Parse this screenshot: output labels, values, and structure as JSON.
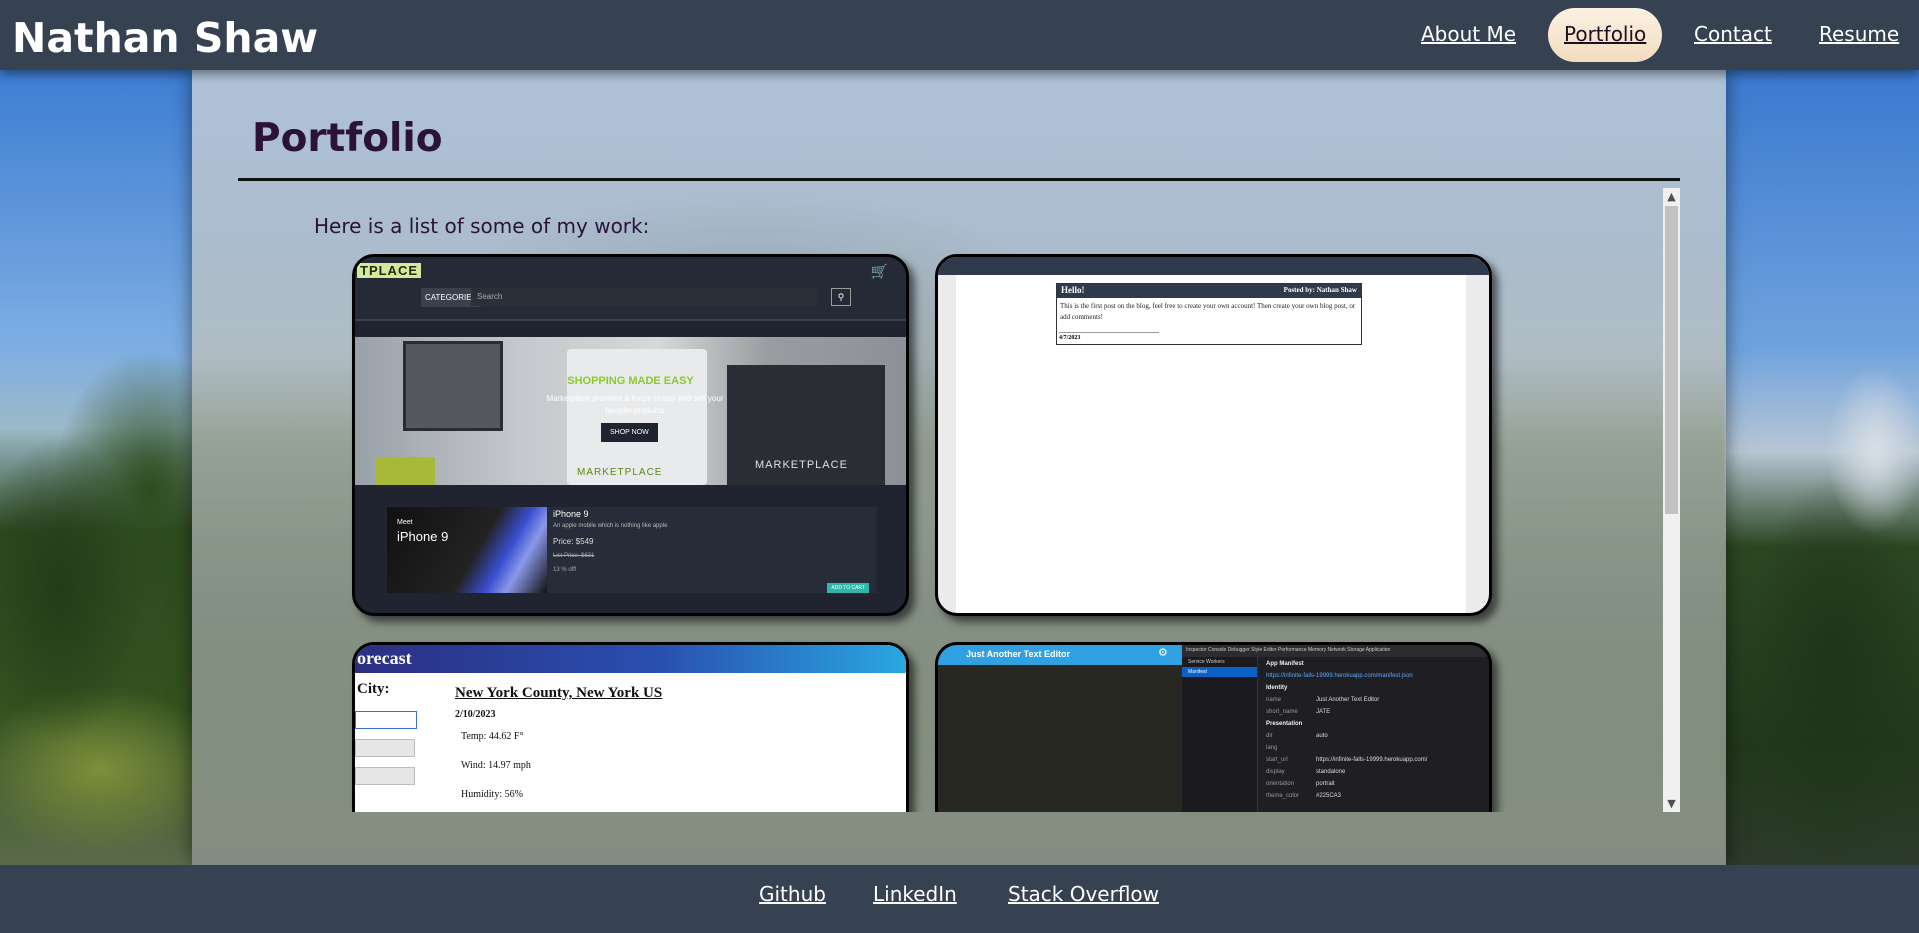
{
  "header": {
    "site_title": "Nathan Shaw",
    "nav": [
      {
        "label": "About Me",
        "active": false
      },
      {
        "label": "Portfolio",
        "active": true
      },
      {
        "label": "Contact",
        "active": false
      },
      {
        "label": "Resume",
        "active": false
      }
    ]
  },
  "main": {
    "heading": "Portfolio",
    "intro": "Here is a list of some of my work:"
  },
  "projects": {
    "marketplace": {
      "logo": "TPLACE",
      "categories_label": "CATEGORIES",
      "search_placeholder": "Search",
      "hero_title": "SHOPPING MADE EASY",
      "hero_subtitle": "Marketplace provides a forum to buy and sell your favorite products",
      "shop_button": "SHOP NOW",
      "brand": "MARKETPLACE",
      "product": {
        "meet": "Meet",
        "image_name": "iPhone 9",
        "title": "iPhone 9",
        "description": "An apple mobile which is nothing like apple",
        "price": "Price: $549",
        "list_price": "List Price: $631",
        "discount": "13 % off!",
        "add_to_cart": "ADD TO CART"
      }
    },
    "blog": {
      "post_title": "Hello!",
      "posted_by": "Posted by: Nathan Shaw",
      "post_body": "This is the first post on the blog, feel free to create your own account! Then create your own blog post, or add comments!",
      "post_date": "4/7/2023"
    },
    "weather": {
      "title": "orecast",
      "city_label": "City:",
      "location": "New York County, New York US",
      "date": "2/10/2023",
      "temp": "Temp: 44.62 F°",
      "wind": "Wind: 14.97 mph",
      "humidity": "Humidity: 56%"
    },
    "text_editor": {
      "app_title": "Just Another Text Editor",
      "toolbar": "Inspector   Console   Debugger   Style Editor   Performance   Memory   Network   Storage   Application",
      "side_items": [
        "Service Workers",
        "Manifest"
      ],
      "panel_title": "App Manifest",
      "manifest_url": "https://infinite-falls-19999.herokuapp.com/manifest.json",
      "identity_label": "Identity",
      "presentation_label": "Presentation",
      "fields": [
        {
          "k": "name",
          "v": "Just Another Text Editor"
        },
        {
          "k": "short_name",
          "v": "JATE"
        }
      ],
      "pres_fields": [
        {
          "k": "dir",
          "v": "auto"
        },
        {
          "k": "lang",
          "v": ""
        },
        {
          "k": "start_url",
          "v": "https://infinite-falls-19999.herokuapp.com/"
        },
        {
          "k": "display",
          "v": "standalone"
        },
        {
          "k": "orientation",
          "v": "portrait"
        },
        {
          "k": "theme_color",
          "v": "#225CA3"
        }
      ]
    }
  },
  "footer": {
    "links": [
      "Github",
      "LinkedIn",
      "Stack Overflow"
    ]
  },
  "colors": {
    "header_bg": "#364152",
    "active_nav_bg": "#f6e4cc",
    "heading_color": "#2a1238"
  }
}
